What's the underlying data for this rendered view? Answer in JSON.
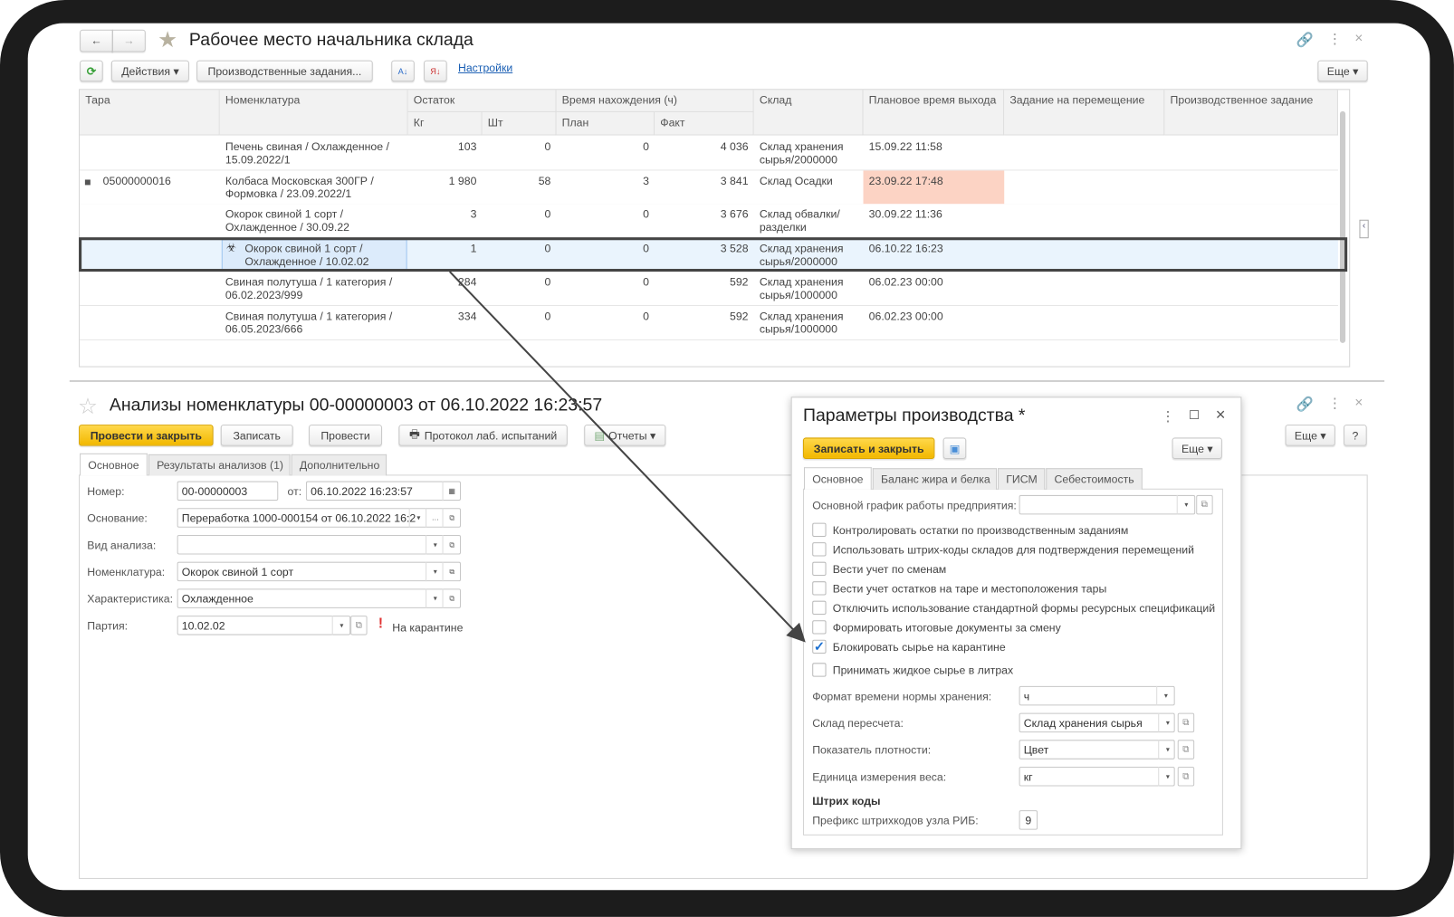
{
  "main": {
    "title": "Рабочее место начальника склада",
    "nav": {
      "back": "←",
      "forward": "→"
    },
    "toolbar": {
      "actions": "Действия ▾",
      "production_tasks": "Производственные задания...",
      "settings_link": "Настройки",
      "more": "Еще ▾"
    },
    "headers": {
      "tara": "Тара",
      "nomenclature": "Номенклатура",
      "remainder": "Остаток",
      "kg": "Кг",
      "pcs": "Шт",
      "time": "Время нахождения (ч)",
      "plan": "План",
      "fact": "Факт",
      "warehouse": "Склад",
      "planned_exit": "Плановое время выхода",
      "move_task": "Задание на перемещение",
      "prod_task": "Производственное задание"
    },
    "rows": [
      {
        "tara": "",
        "nom": "Печень свиная / Охлажденное / 15.09.2022/1",
        "kg": "103",
        "pcs": "0",
        "plan": "0",
        "fact": "4 036",
        "wh": "Склад хранения сырья/2000000",
        "exit": "15.09.22 11:58",
        "move": "",
        "prod": ""
      },
      {
        "tara": "05000000016",
        "nom": "Колбаса Московская 300ГР / Формовка / 23.09.2022/1",
        "kg": "1 980",
        "pcs": "58",
        "plan": "3",
        "fact": "3 841",
        "wh": "Склад Осадки",
        "exit": "23.09.22 17:48",
        "move": "",
        "prod": "",
        "overdue": true
      },
      {
        "tara": "",
        "nom": "Окорок свиной 1 сорт / Охлажденное / 30.09.22",
        "kg": "3",
        "pcs": "0",
        "plan": "0",
        "fact": "3 676",
        "wh": "Склад обвалки/разделки",
        "exit": "30.09.22 11:36",
        "move": "",
        "prod": ""
      },
      {
        "tara": "",
        "nom": "Окорок свиной 1 сорт / Охлажденное / 10.02.02",
        "kg": "1",
        "pcs": "0",
        "plan": "0",
        "fact": "3 528",
        "wh": "Склад хранения сырья/2000000",
        "exit": "06.10.22 16:23",
        "move": "",
        "prod": "",
        "selected": true,
        "quarantine": true
      },
      {
        "tara": "",
        "nom": "Свиная полутуша / 1 категория / 06.02.2023/999",
        "kg": "284",
        "pcs": "0",
        "plan": "0",
        "fact": "592",
        "wh": "Склад хранения сырья/1000000",
        "exit": "06.02.23 00:00",
        "move": "",
        "prod": ""
      },
      {
        "tara": "",
        "nom": "Свиная полутуша / 1 категория / 06.05.2023/666",
        "kg": "334",
        "pcs": "0",
        "plan": "0",
        "fact": "592",
        "wh": "Склад хранения сырья/1000000",
        "exit": "06.02.23 00:00",
        "move": "",
        "prod": ""
      }
    ]
  },
  "doc": {
    "title": "Анализы номенклатуры 00-00000003 от 06.10.2022 16:23:57",
    "buttons": {
      "post_close": "Провести и закрыть",
      "save": "Записать",
      "post": "Провести",
      "protocol": "Протокол лаб. испытаний",
      "reports": "Отчеты ▾",
      "more": "Еще ▾",
      "help": "?"
    },
    "tabs": [
      "Основное",
      "Результаты анализов (1)",
      "Дополнительно"
    ],
    "fields": {
      "number_label": "Номер:",
      "number": "00-00000003",
      "date_label": "от:",
      "date": "06.10.2022 16:23:57",
      "basis_label": "Основание:",
      "basis": "Переработка 1000-000154 от 06.10.2022 16:2",
      "kind_label": "Вид анализа:",
      "kind": "",
      "nom_label": "Номенклатура:",
      "nom": "Окорок свиной 1 сорт",
      "char_label": "Характеристика:",
      "char": "Охлажденное",
      "batch_label": "Партия:",
      "batch": "10.02.02",
      "quarantine": "На карантине"
    }
  },
  "dialog": {
    "title": "Параметры производства *",
    "save_close": "Записать и закрыть",
    "more": "Еще ▾",
    "tabs": [
      "Основное",
      "Баланс жира и белка",
      "ГИСМ",
      "Себестоимость"
    ],
    "schedule_label": "Основной график работы предприятия:",
    "schedule": "",
    "checks": [
      {
        "label": "Контролировать остатки по производственным заданиям",
        "checked": false
      },
      {
        "label": "Использовать штрих-коды складов для подтверждения перемещений",
        "checked": false
      },
      {
        "label": "Вести учет по сменам",
        "checked": false
      },
      {
        "label": "Вести учет остатков на таре и местоположения тары",
        "checked": false
      },
      {
        "label": "Отключить использование стандартной формы ресурсных спецификаций",
        "checked": false
      },
      {
        "label": "Формировать итоговые документы за смену",
        "checked": false
      },
      {
        "label": "Блокировать сырье на карантине",
        "checked": true
      },
      {
        "label": "Принимать жидкое сырье в литрах",
        "checked": false
      }
    ],
    "fields": {
      "time_format_label": "Формат времени нормы хранения:",
      "time_format": "ч",
      "recalc_wh_label": "Склад пересчета:",
      "recalc_wh": "Склад хранения сырья",
      "density_label": "Показатель плотности:",
      "density": "Цвет",
      "weight_unit_label": "Единица измерения веса:",
      "weight_unit": "кг",
      "barcodes_header": "Штрих коды",
      "prefix_label": "Префикс штрихкодов узла РИБ:",
      "prefix": "9"
    }
  },
  "colors": {
    "accent_yellow": "#f5c000",
    "overdue": "#fcd3c4",
    "selected_row": "#eaf4fd",
    "link": "#1a5fb4"
  }
}
